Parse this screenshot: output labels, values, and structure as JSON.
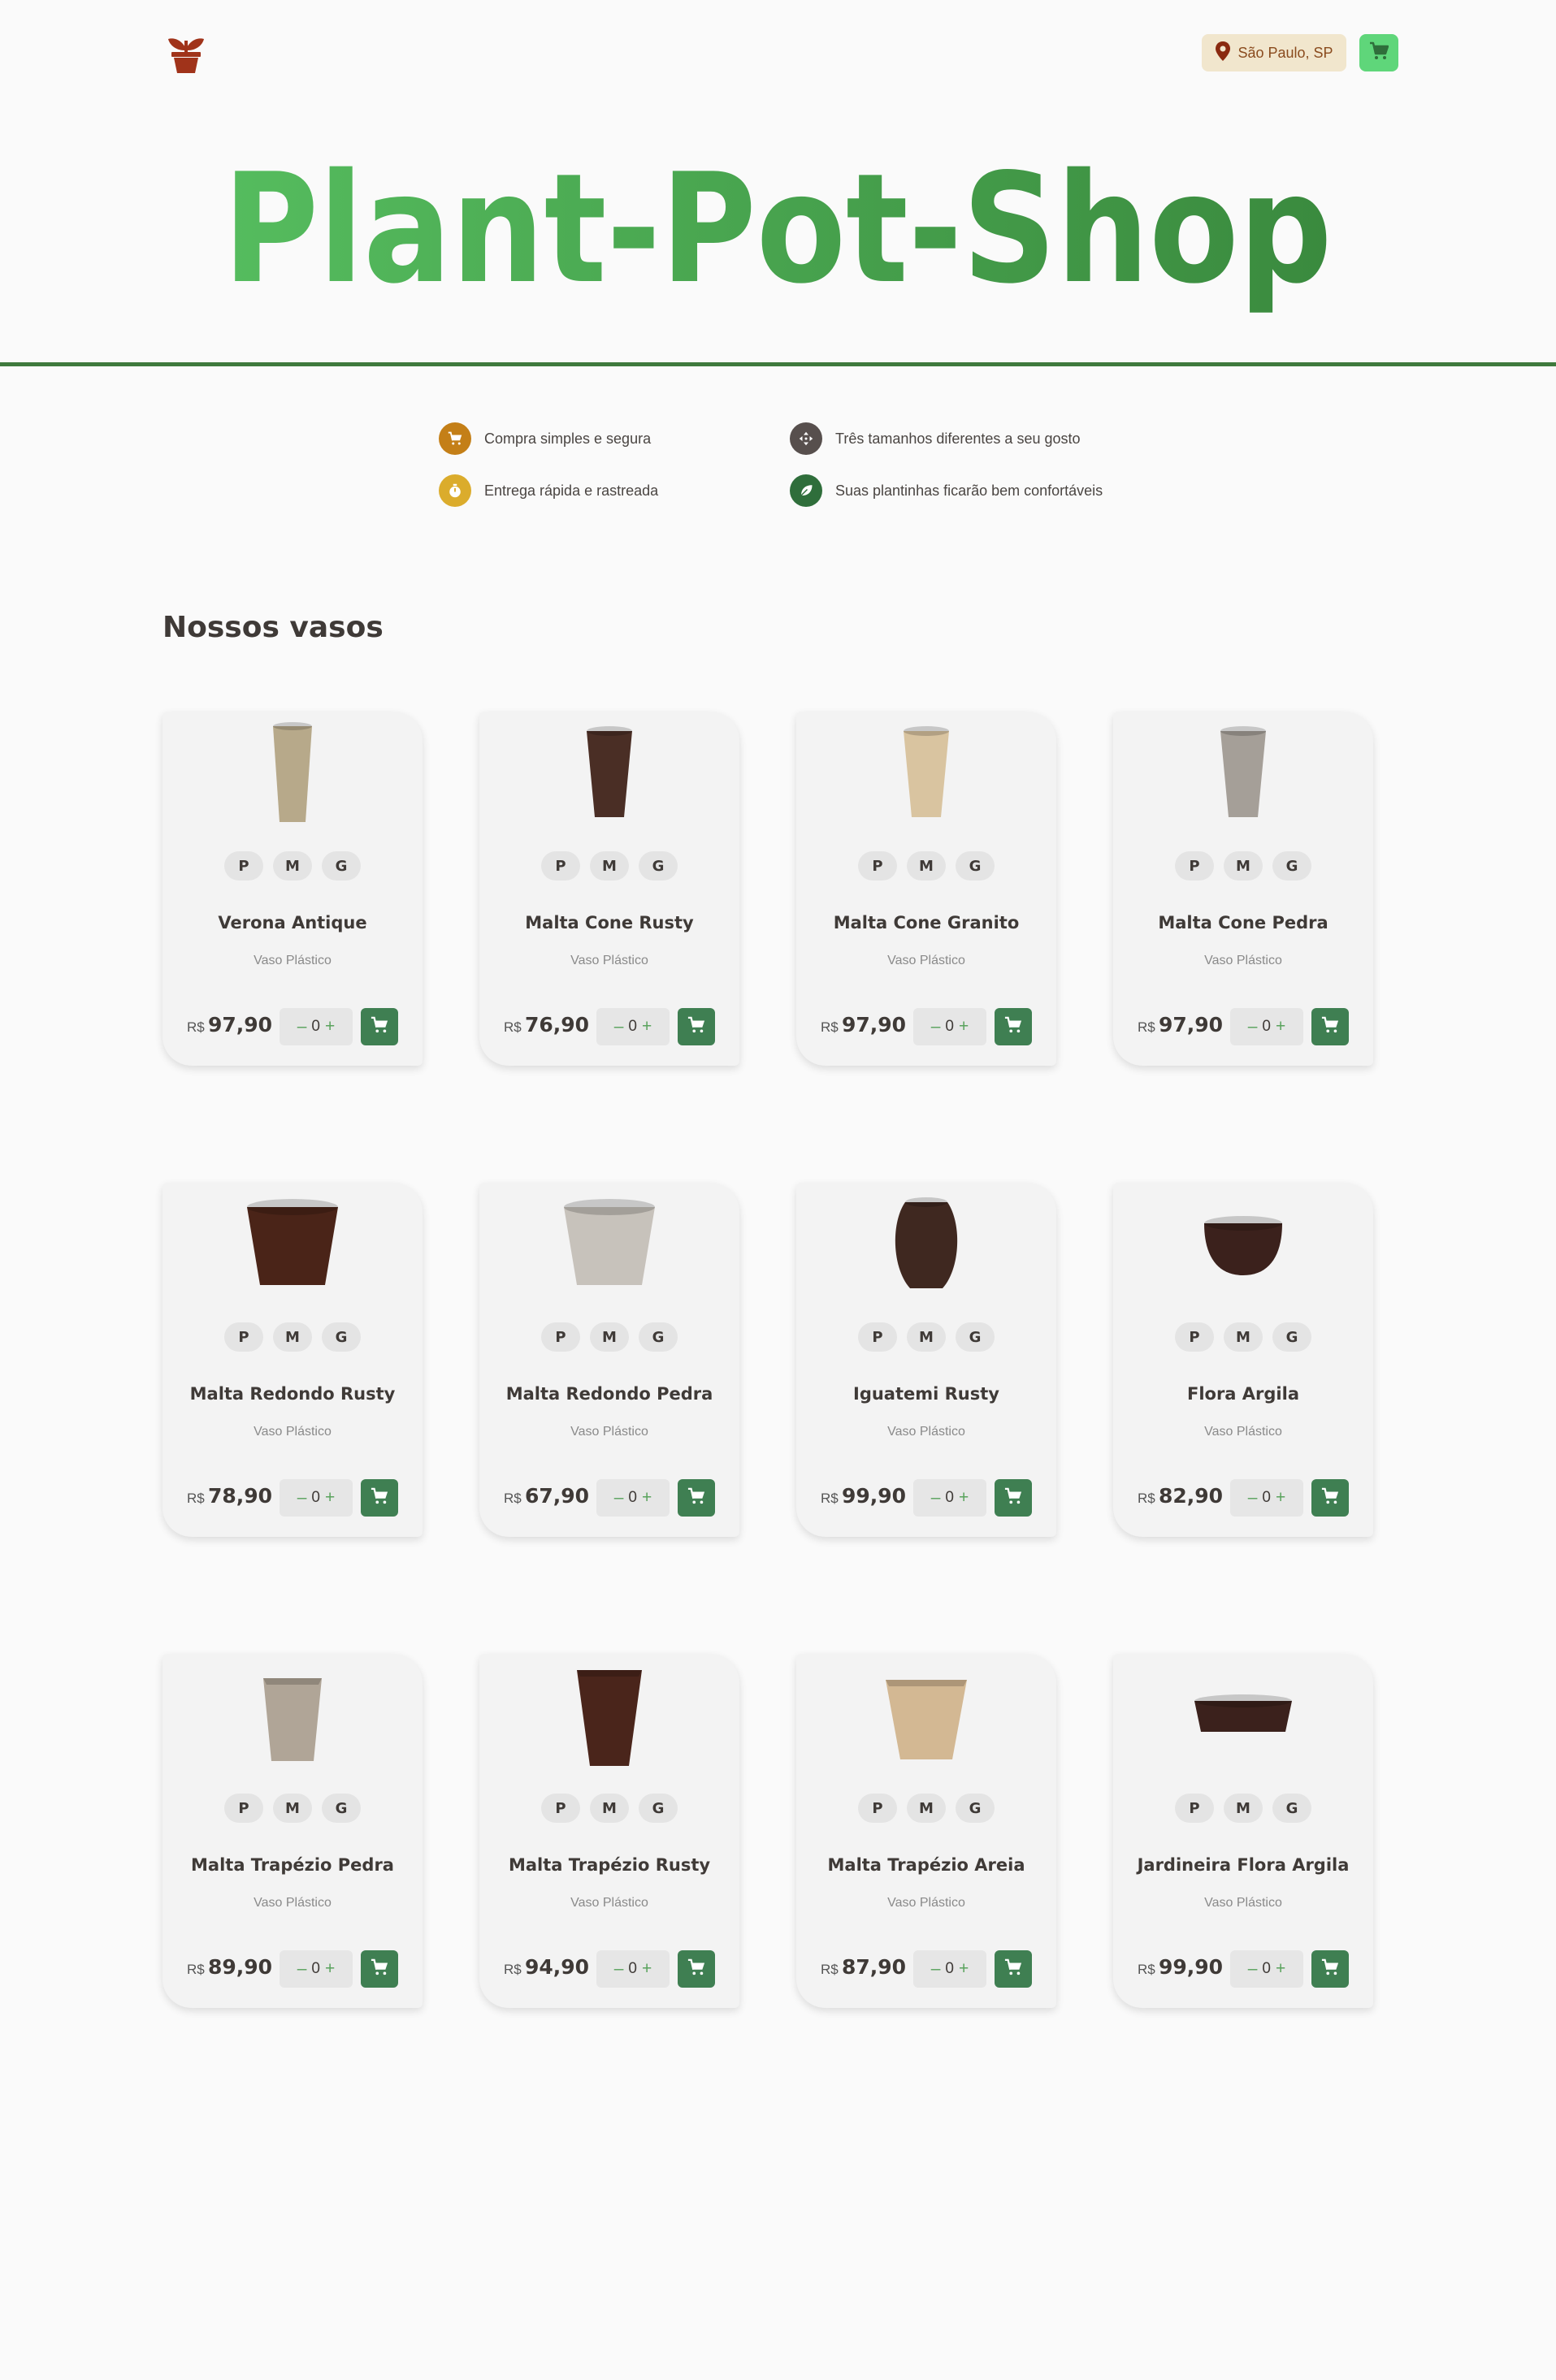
{
  "header": {
    "logo_icon": "plant-pot-logo-icon",
    "location": "São Paulo, SP",
    "location_icon": "map-pin-icon",
    "cart_icon": "shopping-cart-icon"
  },
  "hero": {
    "title": "Plant-Pot-Shop"
  },
  "features": [
    {
      "icon": "shopping-cart-icon",
      "color": "#c47f17",
      "text": "Compra simples e segura"
    },
    {
      "icon": "timer-icon",
      "color": "#dbac2c",
      "text": "Entrega rápida e rastreada"
    },
    {
      "icon": "move-arrows-icon",
      "color": "#574f4d",
      "text": "Três tamanhos diferentes a seu gosto"
    },
    {
      "icon": "leaf-icon",
      "color": "#2f6e3b",
      "text": "Suas plantinhas ficarão bem confortáveis"
    }
  ],
  "section": {
    "title": "Nossos vasos"
  },
  "sizes": [
    "P",
    "M",
    "G"
  ],
  "currency": "R$",
  "quantity": "0",
  "minus_label": "–",
  "plus_label": "+",
  "products": [
    {
      "name": "Verona Antique",
      "type": "Vaso Plástico",
      "price": "97,90",
      "shape": "tall",
      "color": "#b7a98a"
    },
    {
      "name": "Malta Cone Rusty",
      "type": "Vaso Plástico",
      "price": "76,90",
      "shape": "cone",
      "color": "#4a2e25"
    },
    {
      "name": "Malta Cone Granito",
      "type": "Vaso Plástico",
      "price": "97,90",
      "shape": "cone",
      "color": "#d9c4a0"
    },
    {
      "name": "Malta Cone Pedra",
      "type": "Vaso Plástico",
      "price": "97,90",
      "shape": "cone",
      "color": "#a59f98"
    },
    {
      "name": "Malta Redondo Rusty",
      "type": "Vaso Plástico",
      "price": "78,90",
      "shape": "round",
      "color": "#4a2418"
    },
    {
      "name": "Malta Redondo Pedra",
      "type": "Vaso Plástico",
      "price": "67,90",
      "shape": "round",
      "color": "#c7c2bb"
    },
    {
      "name": "Iguatemi Rusty",
      "type": "Vaso Plástico",
      "price": "99,90",
      "shape": "urn",
      "color": "#3f2820"
    },
    {
      "name": "Flora Argila",
      "type": "Vaso Plástico",
      "price": "82,90",
      "shape": "bowl",
      "color": "#3b211c"
    },
    {
      "name": "Malta Trapézio Pedra",
      "type": "Vaso Plástico",
      "price": "89,90",
      "shape": "square",
      "color": "#b0a597"
    },
    {
      "name": "Malta Trapézio Rusty",
      "type": "Vaso Plástico",
      "price": "94,90",
      "shape": "square-tall",
      "color": "#4a251b"
    },
    {
      "name": "Malta Trapézio Areia",
      "type": "Vaso Plástico",
      "price": "87,90",
      "shape": "square-wide",
      "color": "#d3b893"
    },
    {
      "name": "Jardineira Flora Argila",
      "type": "Vaso Plástico",
      "price": "99,90",
      "shape": "planter",
      "color": "#3b211c"
    }
  ],
  "colors": {
    "brand_green": "#45a34c",
    "brand_dark_green": "#3f7a3d",
    "cart_accent": "#5fd67a",
    "add_to_cart": "#3f7f52",
    "logo": "#a0331a"
  }
}
